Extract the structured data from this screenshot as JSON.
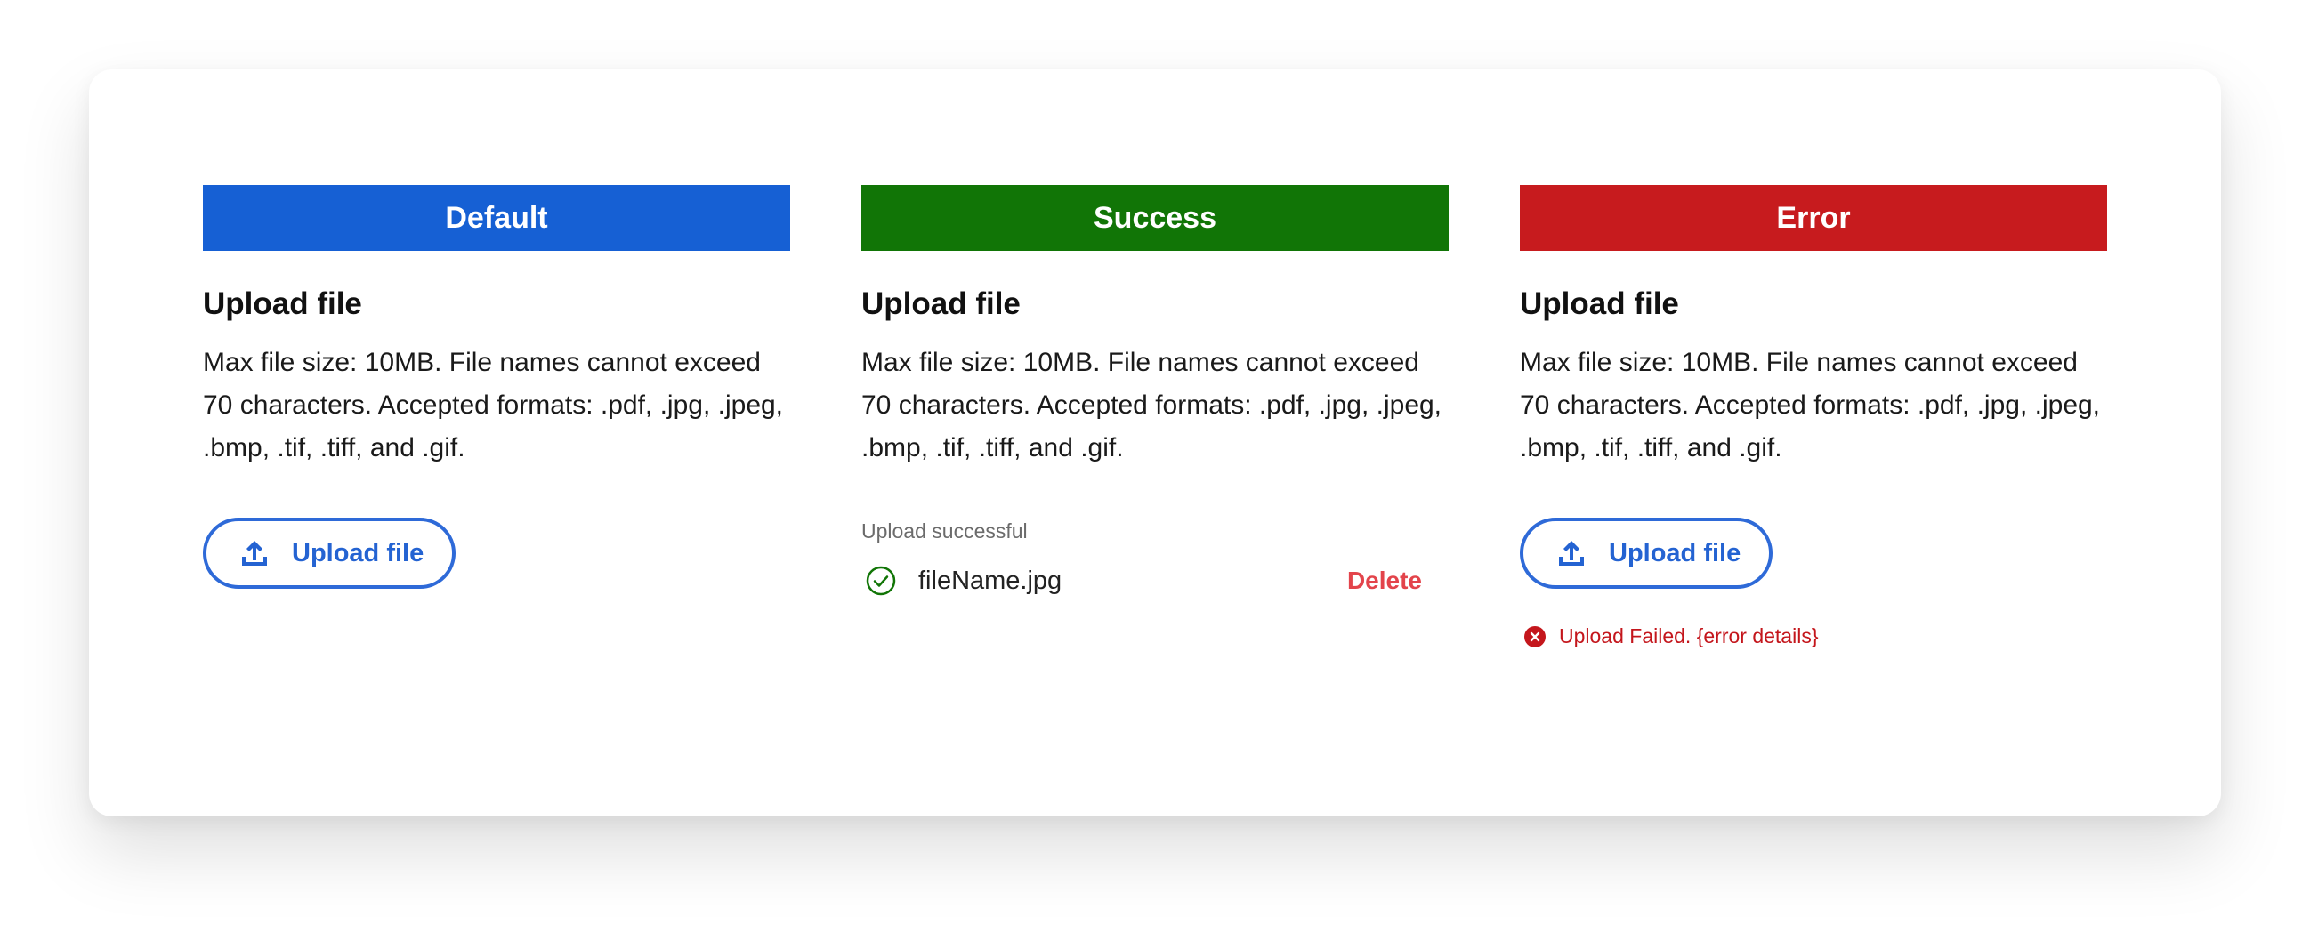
{
  "colors": {
    "default_banner": "#1660d4",
    "success_banner": "#117506",
    "error_banner": "#c71b1e",
    "accent": "#2e6ad8",
    "error_text": "#c4161c",
    "delete": "#e3444b"
  },
  "columns": {
    "default": {
      "banner": "Default",
      "title": "Upload file",
      "description": "Max file size: 10MB. File names cannot exceed 70 characters. Accepted formats: .pdf, .jpg, .jpeg, .bmp, .tif, .tiff, and .gif.",
      "button_label": "Upload file",
      "button_icon": "upload-icon"
    },
    "success": {
      "banner": "Success",
      "title": "Upload file",
      "description": "Max file size: 10MB. File names cannot exceed 70 characters. Accepted formats: .pdf, .jpg, .jpeg, .bmp, .tif, .tiff, and .gif.",
      "status": "Upload successful",
      "file_icon": "check-circle-icon",
      "file_name": "fileName.jpg",
      "delete_label": "Delete"
    },
    "error": {
      "banner": "Error",
      "title": "Upload file",
      "description": "Max file size: 10MB. File names cannot exceed 70 characters. Accepted formats: .pdf, .jpg, .jpeg, .bmp, .tif, .tiff, and .gif.",
      "button_label": "Upload file",
      "button_icon": "upload-icon",
      "error_icon": "error-circle-icon",
      "error_message": "Upload Failed. {error details}"
    }
  }
}
